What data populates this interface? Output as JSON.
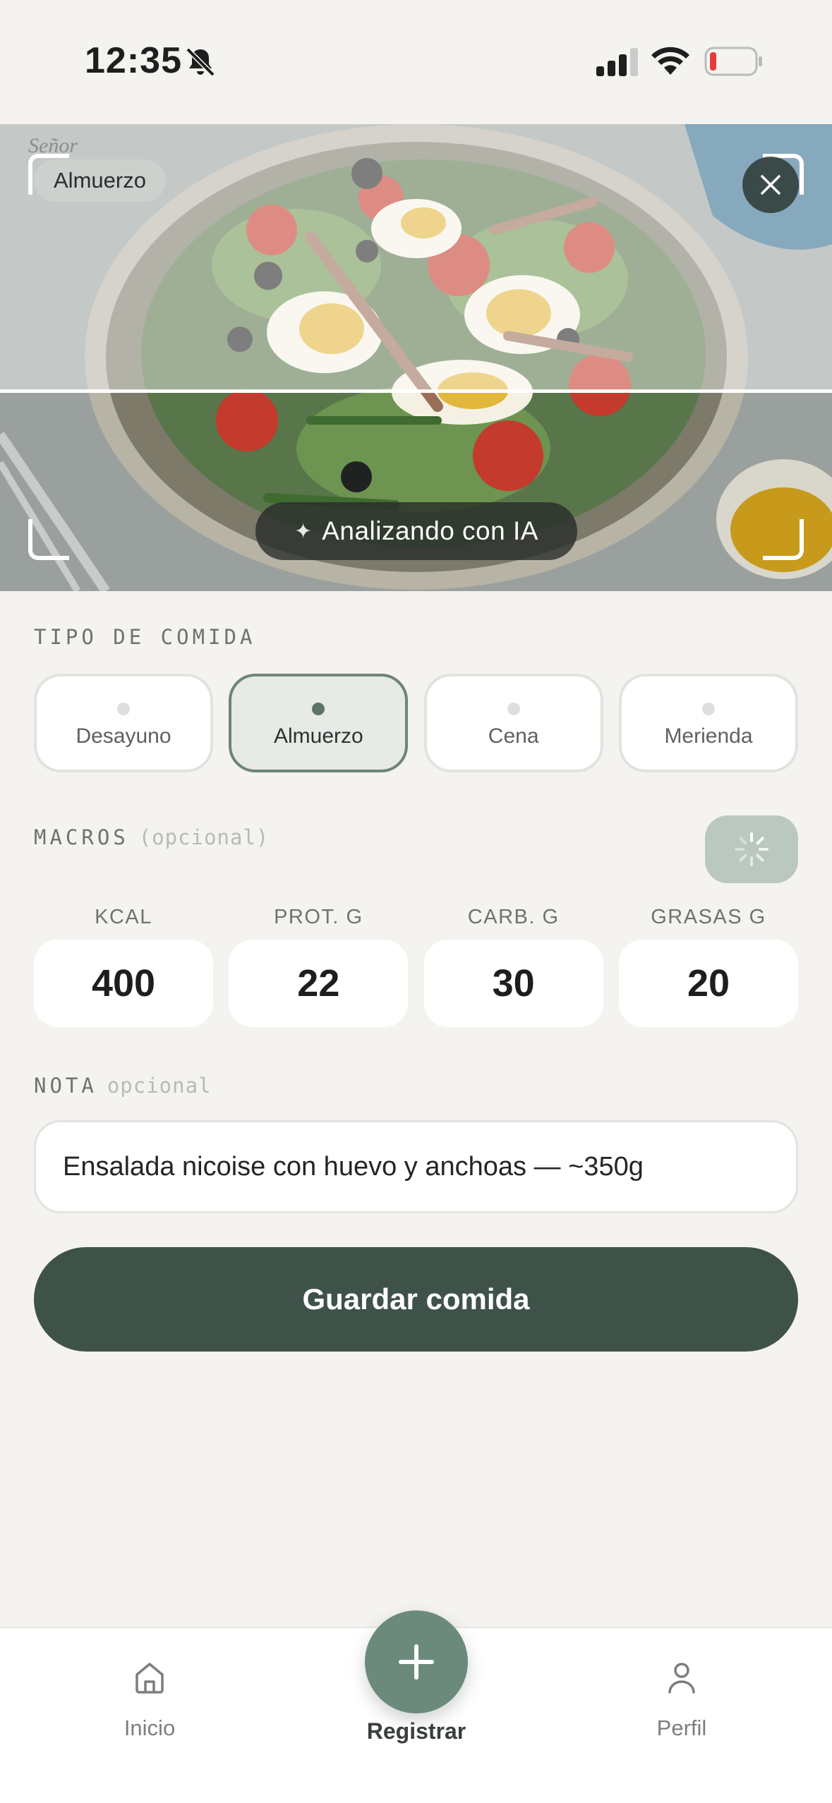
{
  "status_bar": {
    "time": "12:35"
  },
  "photo": {
    "meal_chip": "Almuerzo",
    "ai_status": "Analizando con IA",
    "ai_icon": "sparkle-icon",
    "close_icon": "close-icon"
  },
  "meal_type": {
    "label": "TIPO DE COMIDA",
    "options": [
      "Desayuno",
      "Almuerzo",
      "Cena",
      "Merienda"
    ],
    "selected": "Almuerzo"
  },
  "macros": {
    "label": "MACROS",
    "optional": "(opcional)",
    "items": [
      {
        "label": "KCAL",
        "value": "400"
      },
      {
        "label": "PROT. G",
        "value": "22"
      },
      {
        "label": "CARB. G",
        "value": "30"
      },
      {
        "label": "GRASAS G",
        "value": "20"
      }
    ],
    "loading_icon": "spinner-icon"
  },
  "note": {
    "label": "NOTA",
    "optional": "opcional",
    "value": "Ensalada nicoise con huevo y anchoas — ~350g"
  },
  "save_button": "Guardar comida",
  "nav": {
    "home": "Inicio",
    "register": "Registrar",
    "profile": "Perfil"
  },
  "colors": {
    "accent": "#3f524a",
    "fab": "#6b8a7b",
    "selected_border": "#6e8478",
    "background": "#f4f3ef"
  }
}
